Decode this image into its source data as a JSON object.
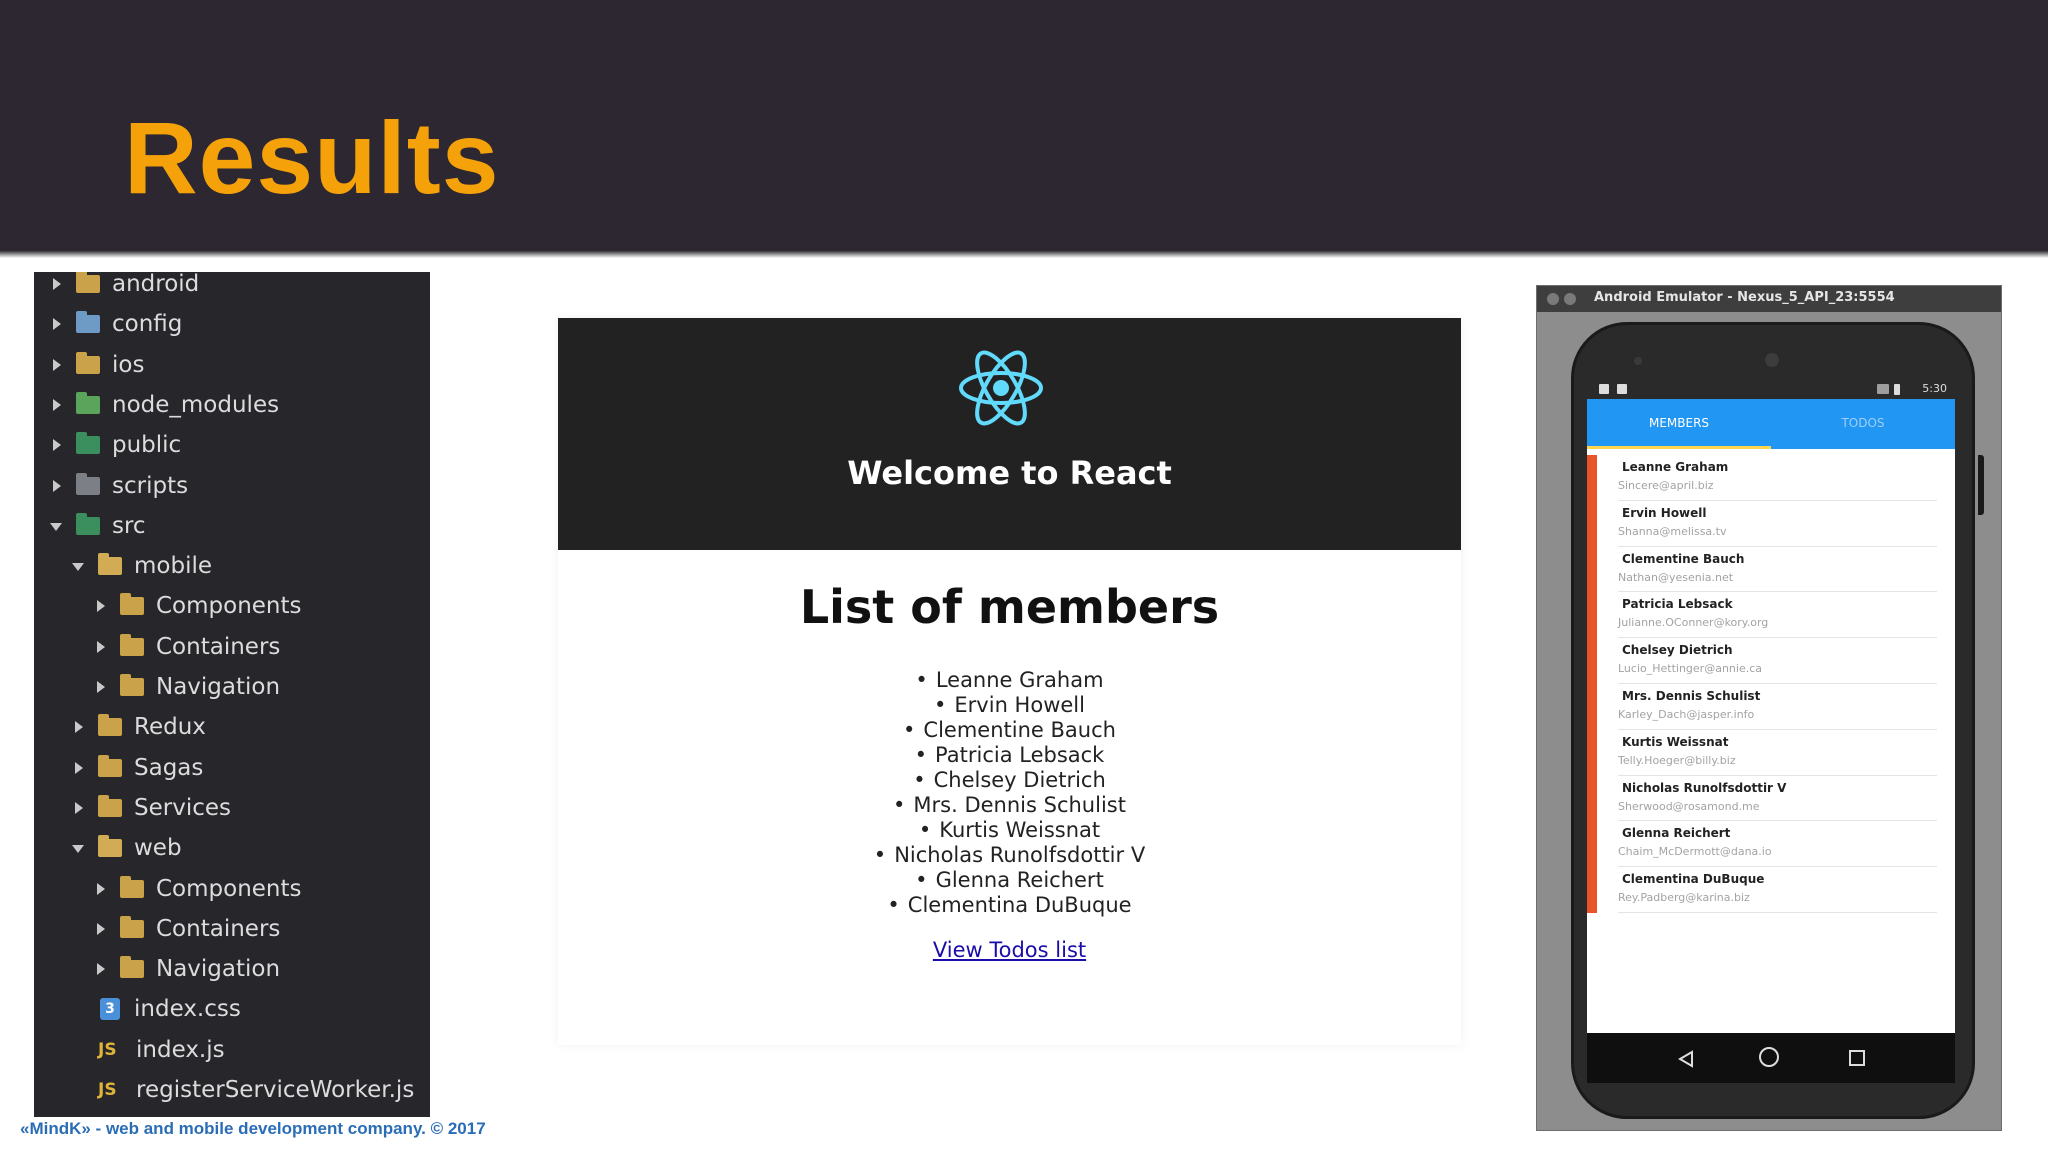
{
  "slide": {
    "title": "Results",
    "footer": "«MindK» -  web and mobile development company. © 2017",
    "colors": {
      "header_bg": "#2d2732",
      "title": "#f5a20a",
      "footer": "#2a6db6"
    }
  },
  "tree": {
    "items": [
      {
        "label": "android",
        "icon": "folder-icon",
        "expanded": false
      },
      {
        "label": "config",
        "icon": "config-folder-icon",
        "expanded": false
      },
      {
        "label": "ios",
        "icon": "folder-icon",
        "expanded": false
      },
      {
        "label": "node_modules",
        "icon": "node-modules-folder-icon",
        "expanded": false
      },
      {
        "label": "public",
        "icon": "public-folder-icon",
        "expanded": false
      },
      {
        "label": "scripts",
        "icon": "scripts-folder-icon",
        "expanded": false
      },
      {
        "label": "src",
        "icon": "src-folder-icon",
        "expanded": true
      },
      {
        "label": "mobile",
        "icon": "open-folder-icon",
        "expanded": true
      },
      {
        "label": "Components",
        "icon": "folder-icon",
        "expanded": false
      },
      {
        "label": "Containers",
        "icon": "folder-icon",
        "expanded": false
      },
      {
        "label": "Navigation",
        "icon": "folder-icon",
        "expanded": false
      },
      {
        "label": "Redux",
        "icon": "folder-icon",
        "expanded": false
      },
      {
        "label": "Sagas",
        "icon": "folder-icon",
        "expanded": false
      },
      {
        "label": "Services",
        "icon": "folder-icon",
        "expanded": false
      },
      {
        "label": "web",
        "icon": "open-folder-icon",
        "expanded": true
      },
      {
        "label": "Components",
        "icon": "folder-icon",
        "expanded": false
      },
      {
        "label": "Containers",
        "icon": "folder-icon",
        "expanded": false
      },
      {
        "label": "Navigation",
        "icon": "folder-icon",
        "expanded": false
      },
      {
        "label": "index.css",
        "icon": "css-file-icon"
      },
      {
        "label": "index.js",
        "icon": "js-file-icon"
      },
      {
        "label": "registerServiceWorker.js",
        "icon": "js-file-icon"
      }
    ]
  },
  "web": {
    "welcome": "Welcome to React",
    "list_title": "List of members",
    "members": [
      "Leanne Graham",
      "Ervin Howell",
      "Clementine Bauch",
      "Patricia Lebsack",
      "Chelsey Dietrich",
      "Mrs. Dennis Schulist",
      "Kurtis Weissnat",
      "Nicholas Runolfsdottir V",
      "Glenna Reichert",
      "Clementina DuBuque"
    ],
    "link": "View Todos list"
  },
  "emulator": {
    "window_title": "Android Emulator - Nexus_5_API_23:5554",
    "status_time": "5:30",
    "tabs": [
      "MEMBERS",
      "TODOS"
    ],
    "accent": "#2196f3",
    "row_accent": "#e8532a",
    "members": [
      {
        "name": "Leanne Graham",
        "email": "Sincere@april.biz"
      },
      {
        "name": "Ervin Howell",
        "email": "Shanna@melissa.tv"
      },
      {
        "name": "Clementine Bauch",
        "email": "Nathan@yesenia.net"
      },
      {
        "name": "Patricia Lebsack",
        "email": "Julianne.OConner@kory.org"
      },
      {
        "name": "Chelsey Dietrich",
        "email": "Lucio_Hettinger@annie.ca"
      },
      {
        "name": "Mrs. Dennis Schulist",
        "email": "Karley_Dach@jasper.info"
      },
      {
        "name": "Kurtis Weissnat",
        "email": "Telly.Hoeger@billy.biz"
      },
      {
        "name": "Nicholas Runolfsdottir V",
        "email": "Sherwood@rosamond.me"
      },
      {
        "name": "Glenna Reichert",
        "email": "Chaim_McDermott@dana.io"
      },
      {
        "name": "Clementina DuBuque",
        "email": "Rey.Padberg@karina.biz"
      }
    ]
  }
}
